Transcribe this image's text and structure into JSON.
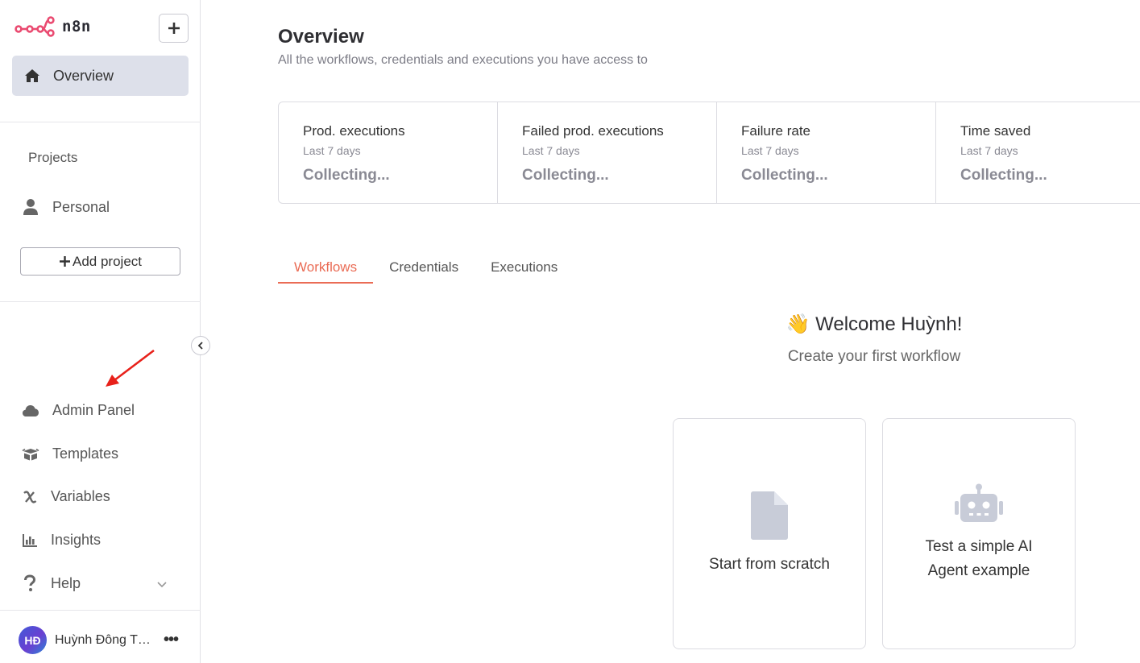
{
  "app": {
    "name": "n8n"
  },
  "sidebar": {
    "overview_label": "Overview",
    "projects_title": "Projects",
    "personal_label": "Personal",
    "add_project_label": "Add project",
    "bottom_items": [
      {
        "label": "Admin Panel",
        "icon": "cloud-icon"
      },
      {
        "label": "Templates",
        "icon": "box-icon"
      },
      {
        "label": "Variables",
        "icon": "variable-x-icon"
      },
      {
        "label": "Insights",
        "icon": "bar-chart-icon"
      },
      {
        "label": "Help",
        "icon": "question-icon"
      }
    ],
    "user": {
      "initials": "HĐ",
      "name": "Huỳnh Đông Thái"
    }
  },
  "main": {
    "title": "Overview",
    "subtitle": "All the workflows, credentials and executions you have access to",
    "stats": [
      {
        "title": "Prod. executions",
        "period": "Last 7 days",
        "value": "Collecting..."
      },
      {
        "title": "Failed prod. executions",
        "period": "Last 7 days",
        "value": "Collecting..."
      },
      {
        "title": "Failure rate",
        "period": "Last 7 days",
        "value": "Collecting..."
      },
      {
        "title": "Time saved",
        "period": "Last 7 days",
        "value": "Collecting..."
      }
    ],
    "tabs": [
      {
        "label": "Workflows",
        "active": true
      },
      {
        "label": "Credentials",
        "active": false
      },
      {
        "label": "Executions",
        "active": false
      }
    ],
    "welcome": {
      "emoji": "👋",
      "title": "Welcome Huỳnh!",
      "subtitle": "Create your first workflow"
    },
    "cards": [
      {
        "label": "Start from scratch",
        "icon": "file-icon"
      },
      {
        "label": "Test a simple AI Agent example",
        "icon": "robot-icon"
      }
    ]
  },
  "colors": {
    "accent": "#ea6c55",
    "logo": "#ea4b71",
    "annotation_arrow": "#e8211a"
  }
}
